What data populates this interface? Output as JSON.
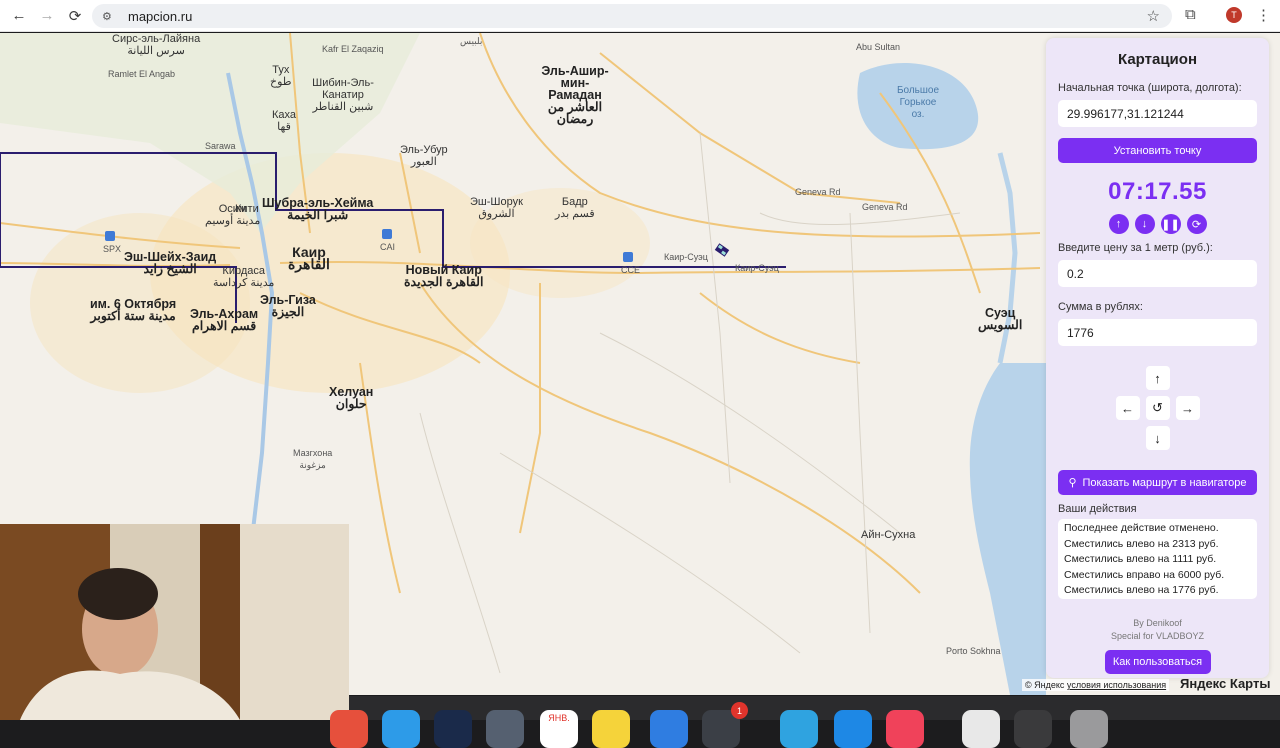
{
  "browser": {
    "url": "mapcion.ru",
    "avatar_letter": "T"
  },
  "panel": {
    "title": "Картацион",
    "start_label": "Начальная точка (широта, долгота):",
    "start_value": "29.996177,31.121244",
    "set_point_button": "Установить точку",
    "timer": "07:17.55",
    "price_label": "Введите цену за 1 метр (руб.):",
    "price_value": "0.2",
    "sum_label": "Сумма в рублях:",
    "sum_value": "1776",
    "route_button": "Показать маршрут в навигаторе",
    "actions_label": "Ваши действия",
    "actions_log": [
      "Последнее действие отменено.",
      "Сместились влево на 2313 руб.",
      "Сместились влево на 1111 руб.",
      "Сместились вправо на 6000 руб.",
      "Сместились влево на 1776 руб."
    ],
    "credit_line1": "By Denikoof",
    "credit_line2": "Special for VLADBOYZ",
    "howto_button": "Как пользоваться"
  },
  "map_labels": [
    {
      "name": "map-label-sirs",
      "text": "Сирс-эль-Лайяна",
      "sub": "سرس الليانة"
    },
    {
      "name": "map-label-bilbeis",
      "text": "بلبيس"
    },
    {
      "name": "map-label-abu-sultan",
      "text": "Abu Sultan"
    },
    {
      "name": "map-label-kafr",
      "text": "Kafr El Zaqaziq"
    },
    {
      "name": "map-label-ramlet",
      "text": "Ramlet El Angab"
    },
    {
      "name": "map-label-tukh",
      "text": "Тух",
      "sub": "طوخ"
    },
    {
      "name": "map-label-shibin",
      "text": "Шибин-Эль-Канатир",
      "sub": "شبين القناطر"
    },
    {
      "name": "map-label-el-ashir",
      "text": "Эль-Ашир-мин-Рамадан",
      "sub": "العاشر من رمضان"
    },
    {
      "name": "map-label-kaha",
      "text": "Каха",
      "sub": "قها"
    },
    {
      "name": "map-label-sarawa",
      "text": "Sarawa"
    },
    {
      "name": "map-label-el-ubur",
      "text": "Эль-Убур",
      "sub": "العبور"
    },
    {
      "name": "map-label-shubra",
      "text": "Шубра-эль-Хейма",
      "sub": "شبرا الخيمة"
    },
    {
      "name": "map-label-osim",
      "text": "Осим",
      "sub": "مدينة أوسيم"
    },
    {
      "name": "map-label-kiti",
      "text": "Кити"
    },
    {
      "name": "map-label-shorouk",
      "text": "Эш-Шорук",
      "sub": "الشروق"
    },
    {
      "name": "map-label-badr",
      "text": "Бадр",
      "sub": "قسم بدر"
    },
    {
      "name": "map-label-sheikh-zayed",
      "text": "Эш-Шейх-Заид",
      "sub": "الشيخ زايد"
    },
    {
      "name": "map-label-cairo",
      "text": "Каир",
      "sub": "القاهرة"
    },
    {
      "name": "map-label-new-cairo",
      "text": "Новый Каир",
      "sub": "القاهرة الجديدة"
    },
    {
      "name": "map-label-kirdasa",
      "text": "Кирдаса",
      "sub": "مدينة كرداسة"
    },
    {
      "name": "map-label-6-october",
      "text": "им. 6 Октября",
      "sub": "مدينة ستة أكتوبر"
    },
    {
      "name": "map-label-el-ahram",
      "text": "Эль-Ахрам",
      "sub": "قسم الاهرام"
    },
    {
      "name": "map-label-giza",
      "text": "Эль-Гиза",
      "sub": "الجيزة"
    },
    {
      "name": "map-label-suez",
      "text": "Суэц",
      "sub": "السويس"
    },
    {
      "name": "map-label-helwan",
      "text": "Хелуан",
      "sub": "حلوان"
    },
    {
      "name": "map-label-mazghona",
      "text": "Мазгхона",
      "sub": "مزغونة"
    },
    {
      "name": "map-label-ain-sokhna",
      "text": "Айн-Сухна"
    },
    {
      "name": "map-label-porto",
      "text": "Porto Sokhna"
    },
    {
      "name": "map-label-bitter-lake",
      "text": "Большое Горькое оз."
    },
    {
      "name": "map-label-spx",
      "text": "SPX"
    },
    {
      "name": "map-label-cai",
      "text": "CAI"
    },
    {
      "name": "map-label-ccc",
      "text": "CCE"
    },
    {
      "name": "map-label-cairo-suez",
      "text": "Каир-Суэц"
    },
    {
      "name": "map-label-cairo-suez-2",
      "text": "Каир-Суэц"
    },
    {
      "name": "map-label-geneva",
      "text": "Geneva Rd"
    },
    {
      "name": "map-label-geneva-2",
      "text": "Geneva Rd"
    }
  ],
  "attribution": {
    "copyright": "© Яндекс",
    "terms": "условия использования",
    "logo": "Яндекс Карты"
  },
  "dock": {
    "calendar_month": "ЯНВ.",
    "badge": "1"
  },
  "colors": {
    "accent": "#7b2ff2",
    "route": "#2a1d6e",
    "water": "#b8d3ea"
  }
}
